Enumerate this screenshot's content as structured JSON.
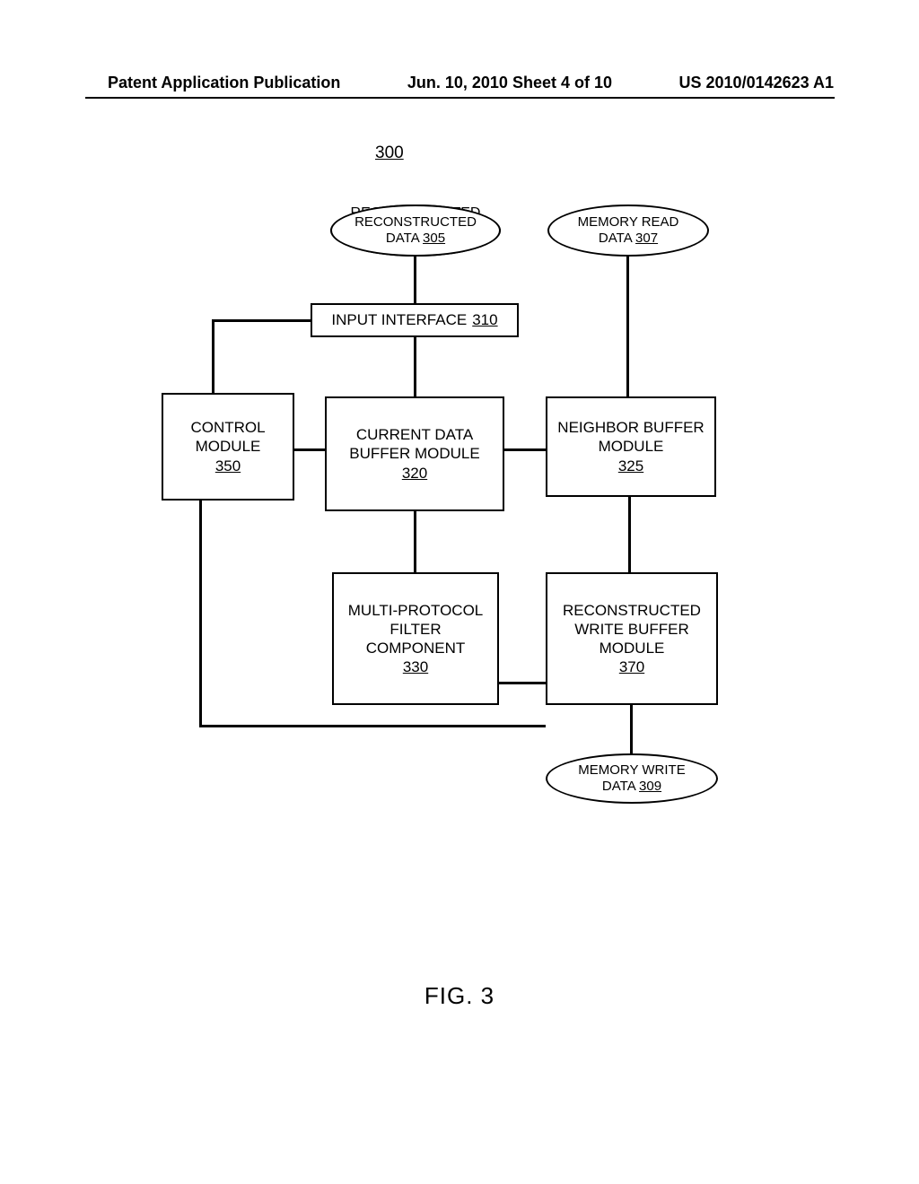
{
  "header": {
    "left": "Patent Application Publication",
    "center": "Jun. 10, 2010  Sheet 4 of 10",
    "right": "US 2010/0142623 A1"
  },
  "diagram_ref": "300",
  "nodes": {
    "recon_data": {
      "label": "RECONSTRUCTED DATA",
      "ref": "305"
    },
    "mem_read": {
      "label": "MEMORY READ DATA",
      "ref": "307"
    },
    "input_if": {
      "label": "INPUT INTERFACE",
      "ref": "310"
    },
    "control": {
      "label": "CONTROL MODULE",
      "ref": "350"
    },
    "cur_buf": {
      "label": "CURRENT DATA BUFFER MODULE",
      "ref": "320"
    },
    "neigh_buf": {
      "label": "NEIGHBOR BUFFER MODULE",
      "ref": "325"
    },
    "filter": {
      "label": "MULTI-PROTOCOL FILTER COMPONENT",
      "ref": "330"
    },
    "recon_write_buf": {
      "label": "RECONSTRUCTED WRITE BUFFER MODULE",
      "ref": "370"
    },
    "mem_write": {
      "label": "MEMORY WRITE DATA",
      "ref": "309"
    }
  },
  "figure_label": "FIG. 3"
}
